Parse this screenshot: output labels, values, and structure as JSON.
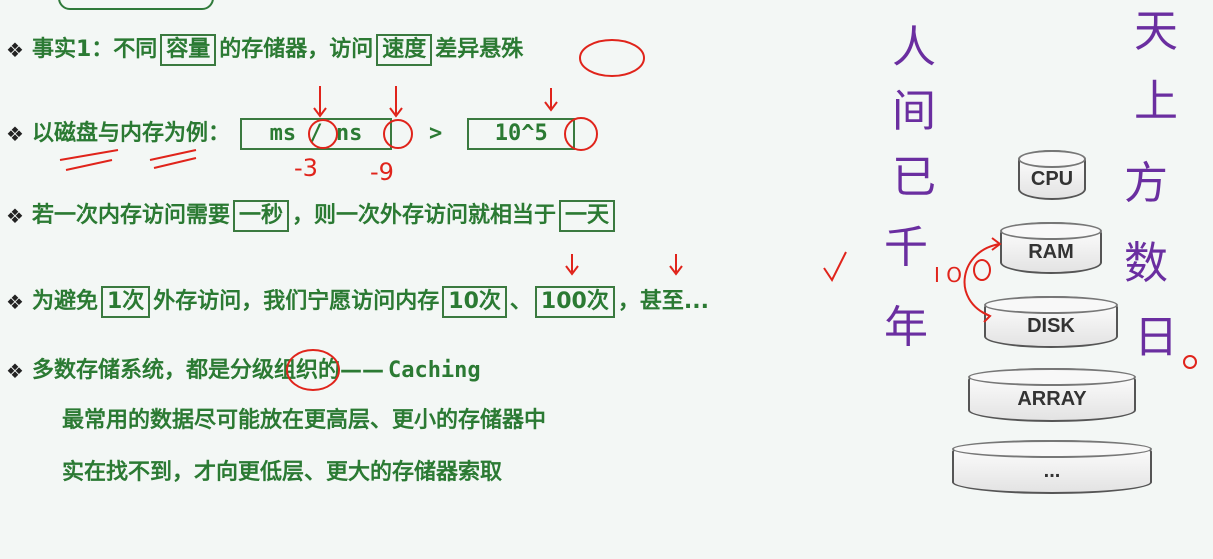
{
  "bullet_symbol": "❖",
  "lines": {
    "l1": {
      "pre": "事实1：不同",
      "box1": "容量",
      "mid": "的存储器，访问",
      "box2": "速度",
      "post": "差异悬殊"
    },
    "l2": {
      "pre": "以磁盘与内存为例：",
      "box1": "ms / ns",
      "gt": ">",
      "box2": "10^5"
    },
    "l3": {
      "pre": "若一次内存访问需要",
      "box1": "一秒",
      "mid": "，则一次外存访问就相当于",
      "box2": "一天"
    },
    "l4": {
      "pre": "为避免",
      "box1": "1次",
      "mid": "外存访问，我们宁愿访问内存",
      "box2": "10次",
      "sep": "、",
      "box3": "100次",
      "post": "，甚至..."
    },
    "l5": {
      "pre": "多数存储系统，都是分级组织的——",
      "mono": "Caching"
    },
    "l6": "最常用的数据尽可能放在更高层、更小的存储器中",
    "l7": "实在找不到，才向更低层、更大的存储器索取"
  },
  "hierarchy": [
    "CPU",
    "RAM",
    "DISK",
    "ARRAY",
    "..."
  ],
  "annotations": {
    "ms_exp": "-3",
    "ns_exp": "-9",
    "io_label": "I O",
    "col1": [
      "人",
      "间",
      "已",
      "千",
      "年"
    ],
    "col2": [
      "天",
      "上",
      "方",
      "数",
      "日"
    ]
  },
  "colors": {
    "text_green": "#2b7a33",
    "ink_red": "#e0241b",
    "ink_purple": "#6a2ea0"
  }
}
